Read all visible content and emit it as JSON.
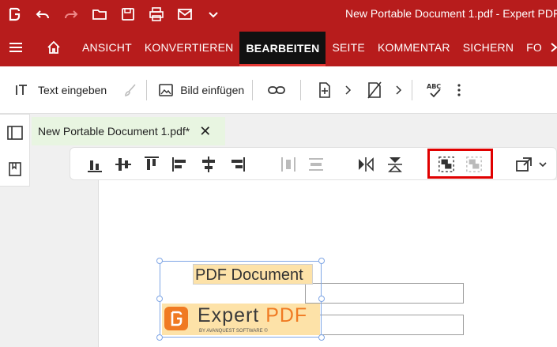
{
  "window": {
    "title": "New Portable Document 1.pdf  -  Expert PDF"
  },
  "titlebar_icons": [
    "app-logo-icon",
    "undo-icon",
    "redo-icon",
    "open-folder-icon",
    "save-icon",
    "print-icon",
    "email-icon",
    "chevron-down-icon"
  ],
  "menu": {
    "items": [
      {
        "label": "ANSICHT"
      },
      {
        "label": "KONVERTIEREN"
      },
      {
        "label": "BEARBEITEN"
      },
      {
        "label": "SEITE"
      },
      {
        "label": "KOMMENTAR"
      },
      {
        "label": "SICHERN"
      },
      {
        "label": "FO"
      }
    ],
    "active": "BEARBEITEN"
  },
  "ribbon": {
    "text_label": "Text eingeben",
    "image_label": "Bild einfügen"
  },
  "tab": {
    "label": "New Portable Document 1.pdf*"
  },
  "document": {
    "text_box": "PDF Document",
    "logo_name_a": "Expert ",
    "logo_name_b": "PDF",
    "logo_sub": "BY AVANQUEST SOFTWARE ©"
  },
  "colors": {
    "brand_red": "#b71c1c",
    "highlight": "#e00000",
    "logo_orange": "#f07a22"
  }
}
